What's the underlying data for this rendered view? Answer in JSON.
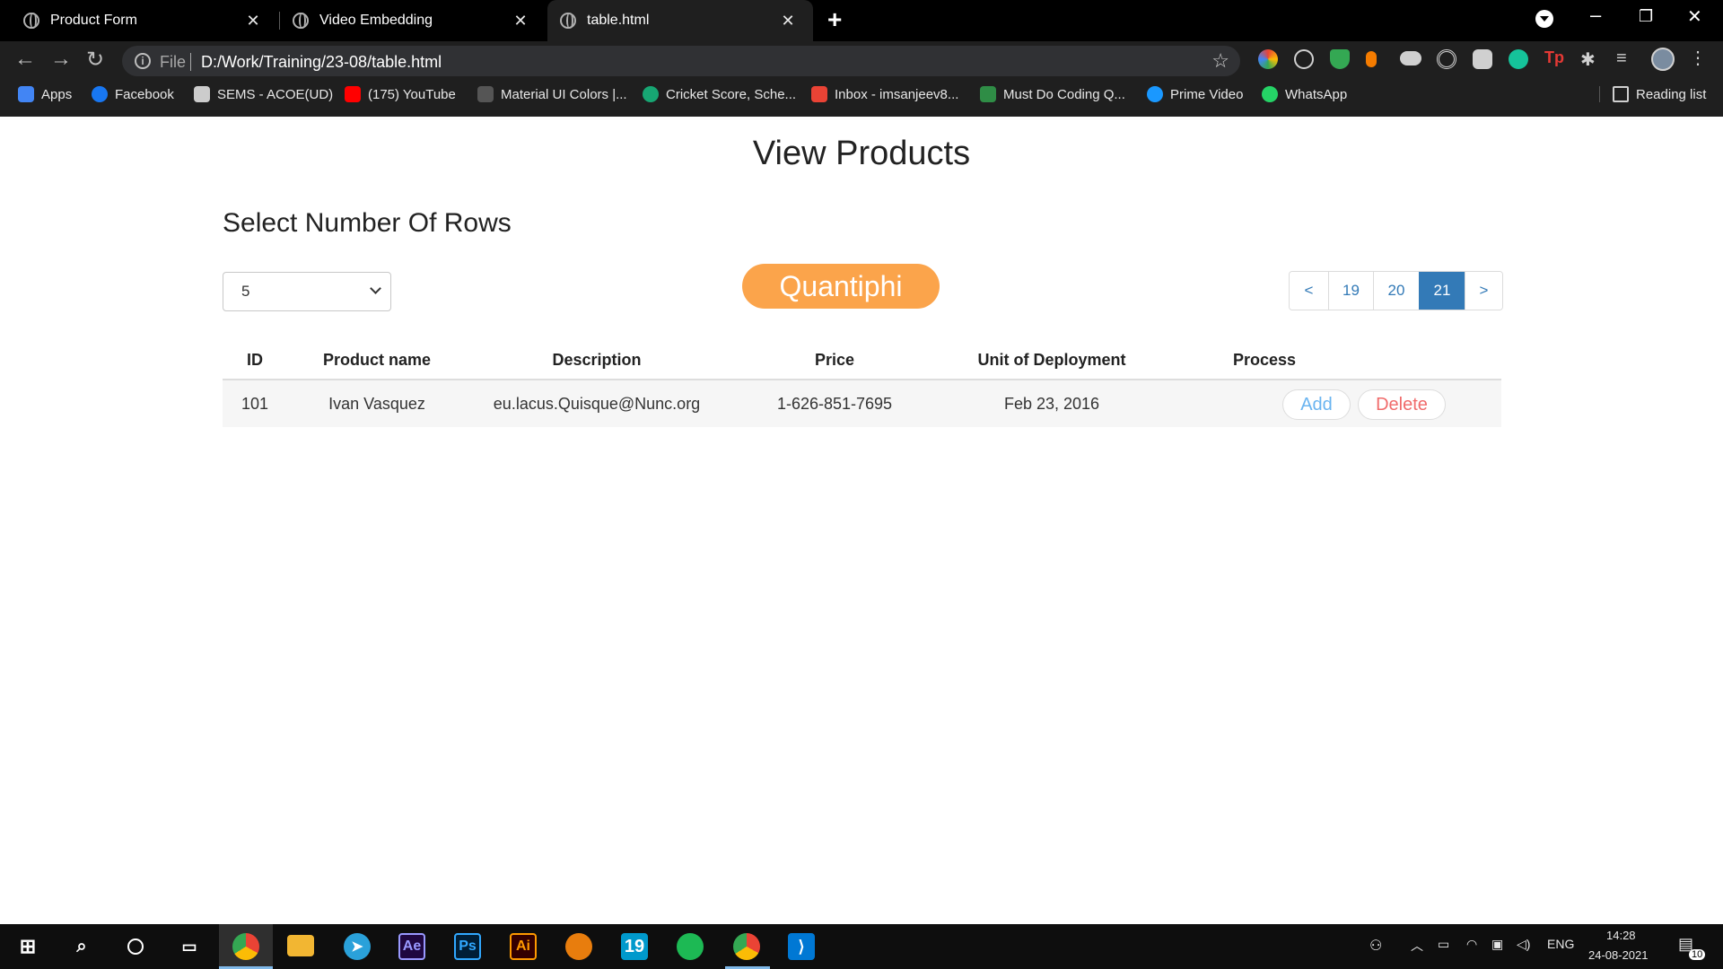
{
  "browser": {
    "tabs": [
      {
        "title": "Product Form",
        "active": false
      },
      {
        "title": "Video Embedding",
        "active": false
      },
      {
        "title": "table.html",
        "active": true
      }
    ],
    "address": {
      "scheme": "File",
      "url": "D:/Work/Training/23-08/table.html"
    },
    "bookmarks": [
      {
        "label": "Apps",
        "icon": "apps-grid-icon",
        "color": "#4285f4"
      },
      {
        "label": "Facebook",
        "icon": "facebook-icon",
        "color": "#1877f2"
      },
      {
        "label": "SEMS - ACOE(UD)",
        "icon": "sems-icon",
        "color": "#cccccc"
      },
      {
        "label": "(175) YouTube",
        "icon": "youtube-icon",
        "color": "#ff0000"
      },
      {
        "label": "Material UI Colors |...",
        "icon": "material-icon",
        "color": "#555555"
      },
      {
        "label": "Cricket Score, Sche...",
        "icon": "cricbuzz-icon",
        "color": "#17a673"
      },
      {
        "label": "Inbox - imsanjeev8...",
        "icon": "gmail-icon",
        "color": "#ea4335"
      },
      {
        "label": "Must Do Coding Q...",
        "icon": "geeksforgeeks-icon",
        "color": "#2f8d46"
      },
      {
        "label": "Prime Video",
        "icon": "prime-video-icon",
        "color": "#1a98ff"
      },
      {
        "label": "WhatsApp",
        "icon": "whatsapp-icon",
        "color": "#25d366"
      }
    ],
    "reading_list": "Reading list"
  },
  "page": {
    "title": "View Products",
    "rows_label": "Select Number Of Rows",
    "rows_value": "5",
    "brand": "Quantiphi",
    "pagination": {
      "prev": "<",
      "pages": [
        "19",
        "20",
        "21"
      ],
      "current": "21",
      "next": ">"
    },
    "table": {
      "headers": [
        "ID",
        "Product name",
        "Description",
        "Price",
        "Unit of Deployment",
        "Process"
      ],
      "rows": [
        {
          "id": "101",
          "name": "Ivan Vasquez",
          "description": "eu.lacus.Quisque@Nunc.org",
          "price": "1-626-851-7695",
          "unit": "Feb 23, 2016"
        }
      ],
      "add_label": "Add",
      "delete_label": "Delete"
    }
  },
  "taskbar": {
    "time": "14:28",
    "date": "24-08-2021",
    "language": "ENG",
    "notifications": "10",
    "apps": [
      "chrome-icon",
      "file-explorer-icon",
      "telegram-icon",
      "after-effects-icon",
      "photoshop-icon",
      "illustrator-icon",
      "blender-icon",
      "app-19-icon",
      "spotify-icon",
      "chrome-profile-icon",
      "vscode-icon"
    ],
    "labels": {
      "ae": "Ae",
      "ps": "Ps",
      "ai": "Ai",
      "n19": "19"
    }
  },
  "colors": {
    "brand": "#fba44b",
    "pagination_active": "#337ab7",
    "add": "#6ab4f0",
    "delete": "#f06b6b"
  }
}
